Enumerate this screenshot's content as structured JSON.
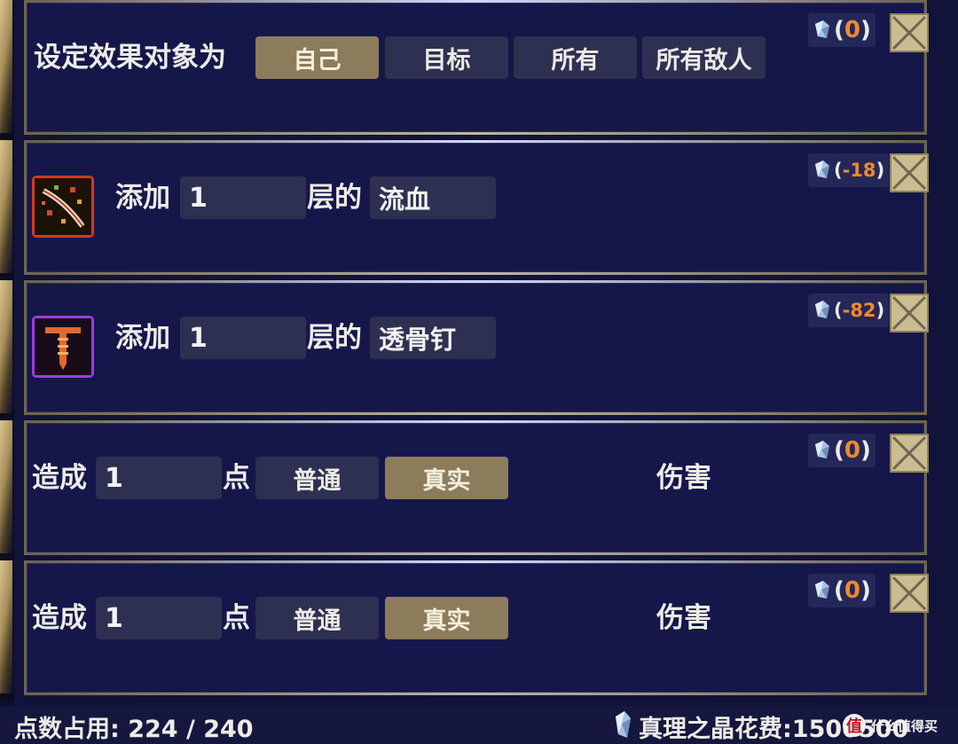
{
  "panels": [
    {
      "label": "设定效果对象为",
      "options": [
        {
          "label": "自己",
          "selected": true
        },
        {
          "label": "目标",
          "selected": false
        },
        {
          "label": "所有",
          "selected": false
        },
        {
          "label": "所有敌人",
          "selected": false
        }
      ],
      "cost": "0",
      "cost_open": "(",
      "cost_close": ")"
    },
    {
      "icon": "bleed-slash-icon",
      "prefix": "添加",
      "value": "1",
      "middle": "层的",
      "status": "流血",
      "cost": "-18",
      "cost_open": "(",
      "cost_close": ")"
    },
    {
      "icon": "bone-nail-icon",
      "prefix": "添加",
      "value": "1",
      "middle": "层的",
      "status": "透骨钉",
      "cost": "-82",
      "cost_open": "(",
      "cost_close": ")"
    },
    {
      "prefix": "造成",
      "value": "1",
      "middle": "点",
      "options": [
        {
          "label": "普通",
          "selected": false
        },
        {
          "label": "真实",
          "selected": true
        }
      ],
      "suffix": "伤害",
      "cost": "0",
      "cost_open": "(",
      "cost_close": ")"
    },
    {
      "prefix": "造成",
      "value": "1",
      "middle": "点",
      "options": [
        {
          "label": "普通",
          "selected": false
        },
        {
          "label": "真实",
          "selected": true
        }
      ],
      "suffix": "伤害",
      "cost": "0",
      "cost_open": "(",
      "cost_close": ")"
    }
  ],
  "footer": {
    "points_label": "点数占用: 224 / 240",
    "crystal_label": "真理之晶花费:1500500"
  },
  "watermark": {
    "logo": "值",
    "text": "什么值得买"
  },
  "colors": {
    "background": "#11133a",
    "panel": "#15174a",
    "option": "#2e3052",
    "option_selected": "#8c7c5b",
    "cost_value": "#f08a2a",
    "close_button": "#cbbd91"
  }
}
